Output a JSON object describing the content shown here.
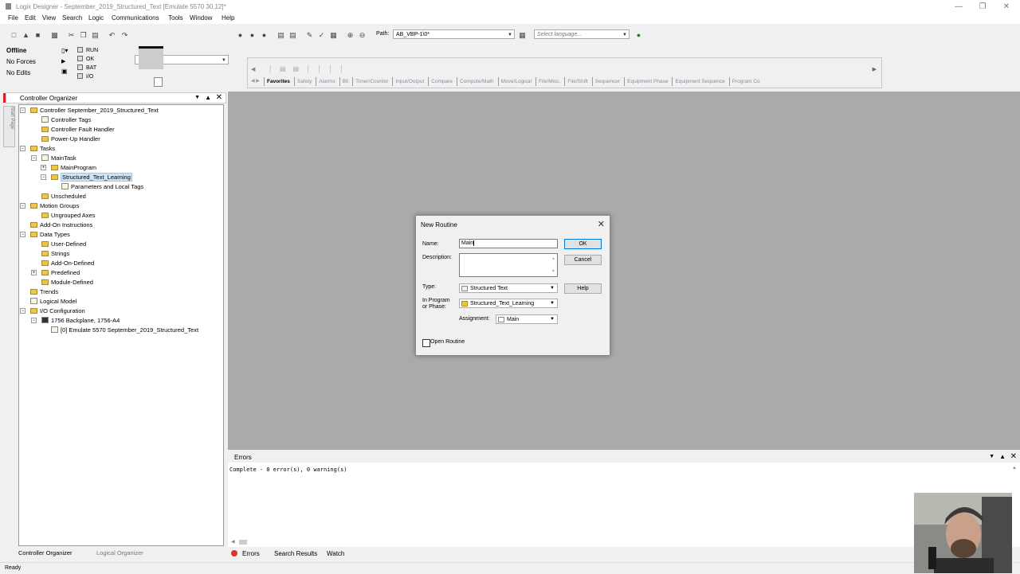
{
  "window": {
    "title": "Logix Designer - September_2019_Structured_Text [Emulate 5570 30.12]*"
  },
  "menu": [
    "File",
    "Edit",
    "View",
    "Search",
    "Logic",
    "Communications",
    "Tools",
    "Window",
    "Help"
  ],
  "toolbar": {
    "path_label": "Path:",
    "path_value": "AB_VBP-1\\0*",
    "language_placeholder": "Select language..."
  },
  "status": {
    "mode": "Offline",
    "forces": "No Forces",
    "edits": "No Edits",
    "flags": [
      "RUN",
      "OK",
      "BAT",
      "I/O"
    ]
  },
  "palette": {
    "tabs": [
      "Favorites",
      "Safety",
      "Alarms",
      "Bit",
      "Timer/Counter",
      "Input/Output",
      "Compare",
      "Compute/Math",
      "Move/Logical",
      "File/Misc.",
      "File/Shift",
      "Sequencer",
      "Equipment Phase",
      "Equipment Sequence",
      "Program Co"
    ]
  },
  "organizer": {
    "title": "Controller Organizer",
    "side_tab": "Start Page",
    "tree": [
      "Controller September_2019_Structured_Text",
      "Controller Tags",
      "Controller Fault Handler",
      "Power-Up Handler",
      "Tasks",
      "MainTask",
      "MainProgram",
      "Structured_Text_Learning",
      "Parameters and Local Tags",
      "Unscheduled",
      "Motion Groups",
      "Ungrouped Axes",
      "Add-On Instructions",
      "Data Types",
      "User-Defined",
      "Strings",
      "Add-On-Defined",
      "Predefined",
      "Module-Defined",
      "Trends",
      "Logical Model",
      "I/O Configuration",
      "1756 Backplane, 1756-A4",
      "[0] Emulate 5570 September_2019_Structured_Text"
    ],
    "bottom_tabs": [
      "Controller Organizer",
      "Logical Organizer"
    ]
  },
  "dialog": {
    "title": "New Routine",
    "name_label": "Name:",
    "name_value": "Main",
    "description_label": "Description:",
    "type_label": "Type:",
    "type_value": "Structured Text",
    "program_label_1": "In Program",
    "program_label_2": "or Phase:",
    "program_value": "Structured_Text_Learning",
    "assignment_label": "Assignment:",
    "assignment_value": "Main",
    "open_routine": "Open Routine",
    "ok": "OK",
    "cancel": "Cancel",
    "help": "Help"
  },
  "errors": {
    "title": "Errors",
    "text": "Complete - 0 error(s), 0 warning(s)",
    "tabs": [
      "Errors",
      "Search Results",
      "Watch"
    ]
  },
  "statusbar": {
    "text": "Ready"
  }
}
